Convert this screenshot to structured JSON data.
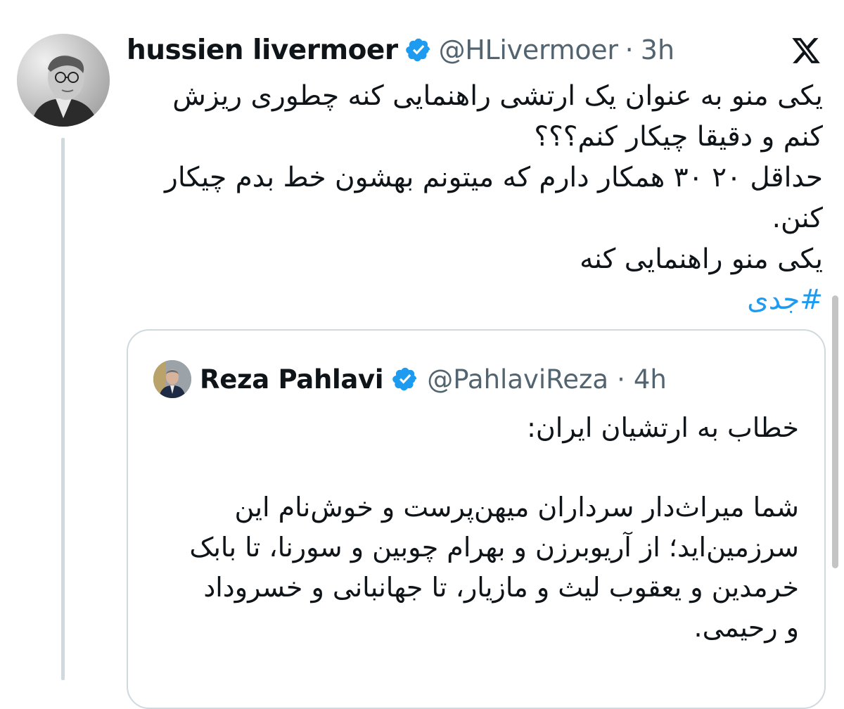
{
  "tweet": {
    "author_name": "hussien livermoer",
    "handle": "@HLivermoer",
    "separator": "·",
    "time": "3h",
    "lines": [
      "یکی منو به عنوان یک ارتشی راهنمایی کنه چطوری ریزش",
      "کنم و دقیقا چیکار کنم؟؟؟",
      "حداقل ۲۰ ۳۰ همکار دارم که میتونم بهشون خط بدم چیکار",
      "کنن.",
      "یکی منو راهنمایی کنه"
    ],
    "hashtag": "#جدی"
  },
  "quote": {
    "author_name": "Reza Pahlavi",
    "handle": "@PahlaviReza",
    "separator": "·",
    "time": "4h",
    "title": "خطاب به ارتشیان ایران:",
    "lines": [
      "شما میراث‌دار سرداران میهن‌پرست و خوش‌نام این",
      "سرزمین‌اید؛ از آریوبرزن و بهرام چوبین و سورنا، تا بابک",
      "خرمدین و یعقوب لیث و مازیار، تا جهانبانی و خسروداد",
      "و رحیمی."
    ]
  },
  "icons": {
    "verified": "verified-badge-icon",
    "platform": "x-logo-icon"
  },
  "colors": {
    "verified": "#1d9bf0",
    "hashtag": "#1d9bf0",
    "secondary_text": "#536471",
    "border": "#cfd9de"
  }
}
